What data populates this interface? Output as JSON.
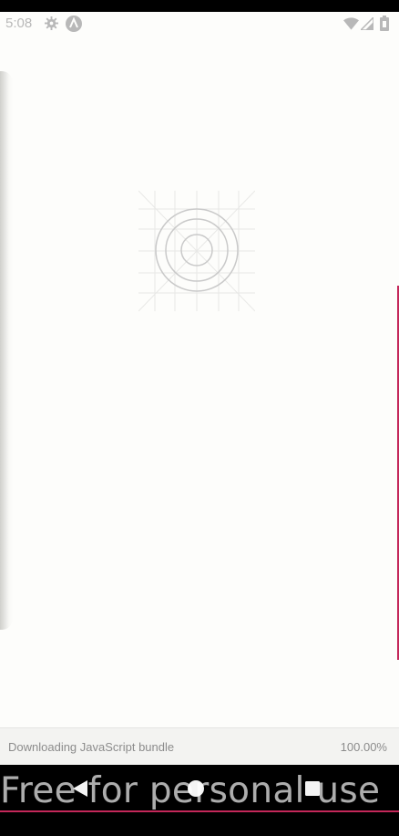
{
  "status_bar": {
    "time": "5:08",
    "icons": [
      "gear-icon",
      "a-notification-icon",
      "wifi-icon",
      "signal-icon",
      "battery-icon"
    ]
  },
  "content": {
    "logo": "concentric-circles-grid-icon"
  },
  "progress": {
    "text": "Downloading JavaScript bundle",
    "percent": "100.00%"
  },
  "navigation": {
    "buttons": [
      "back",
      "home",
      "recents"
    ]
  },
  "watermark": {
    "text": "Free for personal use"
  },
  "colors": {
    "screen_background": "#fdfdfb",
    "status_icons": "#b8b8b8",
    "progress_text": "#8c8c8c",
    "accent": "#c4285a"
  }
}
